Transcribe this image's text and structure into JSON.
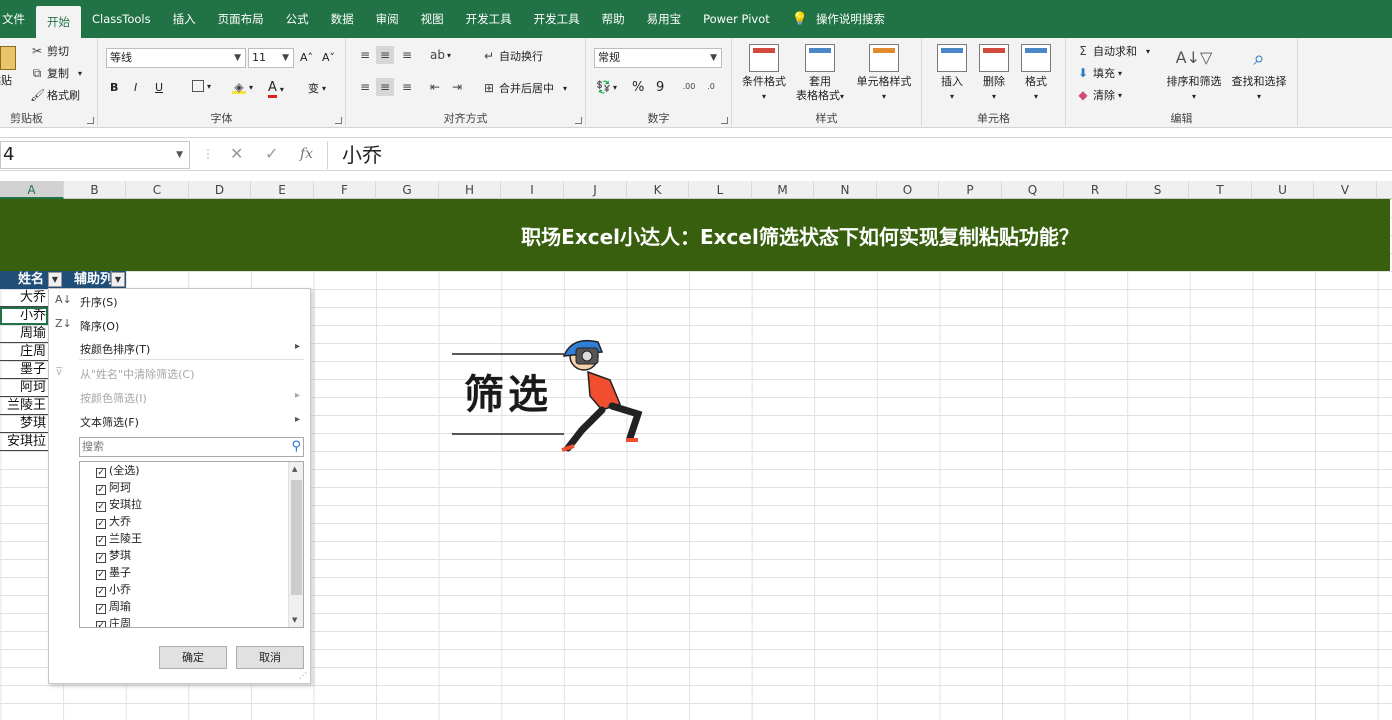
{
  "ribbon_tabs": [
    "文件",
    "开始",
    "ClassTools",
    "插入",
    "页面布局",
    "公式",
    "数据",
    "审阅",
    "视图",
    "开发工具",
    "开发工具",
    "帮助",
    "易用宝",
    "Power Pivot",
    "操作说明搜索"
  ],
  "clipboard": {
    "paste": "粘贴",
    "cut": "剪切",
    "copy": "复制",
    "format_painter": "格式刷",
    "label": "剪贴板"
  },
  "font": {
    "name": "等线",
    "size": "11",
    "bold": "B",
    "italic": "I",
    "underline": "U",
    "grow": "A˄",
    "shrink": "A˅",
    "color_a": "A",
    "phonetic": "变",
    "label": "字体"
  },
  "alignment": {
    "wrap": "自动换行",
    "merge": "合并后居中",
    "label": "对齐方式"
  },
  "number": {
    "format": "常规",
    "percent": "%",
    "comma": "9",
    "label": "数字"
  },
  "styles": {
    "conditional": "条件格式",
    "as_table_1": "套用",
    "as_table_2": "表格格式",
    "cell_styles": "单元格样式",
    "label": "样式"
  },
  "cells": {
    "insert": "插入",
    "delete": "删除",
    "format": "格式",
    "label": "单元格"
  },
  "editing": {
    "autosum": "自动求和",
    "fill": "填充",
    "clear": "清除",
    "sort_filter": "排序和筛选",
    "find_select": "查找和选择",
    "label": "编辑"
  },
  "formula_bar": {
    "name_box": "4",
    "value": "小乔",
    "fx": "fx"
  },
  "columns": [
    "A",
    "B",
    "C",
    "D",
    "E",
    "F",
    "G",
    "H",
    "I",
    "J",
    "K",
    "L",
    "M",
    "N",
    "O",
    "P",
    "Q",
    "R",
    "S",
    "T",
    "U",
    "V"
  ],
  "banner_title": "职场Excel小达人：Excel筛选状态下如何实现复制粘贴功能？",
  "table": {
    "headers": [
      "姓名",
      "辅助列"
    ],
    "names": [
      "大乔",
      "小乔",
      "周瑜",
      "庄周",
      "墨子",
      "阿珂",
      "兰陵王",
      "梦琪",
      "安琪拉"
    ]
  },
  "filter_menu": {
    "sort_asc": "升序(S)",
    "sort_desc": "降序(O)",
    "sort_by_color": "按颜色排序(T)",
    "clear_filter": "从\"姓名\"中清除筛选(C)",
    "filter_by_color": "按颜色筛选(I)",
    "text_filter": "文本筛选(F)",
    "search_placeholder": "搜索",
    "items": [
      "(全选)",
      "阿珂",
      "安琪拉",
      "大乔",
      "兰陵王",
      "梦琪",
      "墨子",
      "小乔",
      "周瑜",
      "庄周"
    ],
    "ok": "确定",
    "cancel": "取消"
  },
  "sticker_text": "筛选"
}
